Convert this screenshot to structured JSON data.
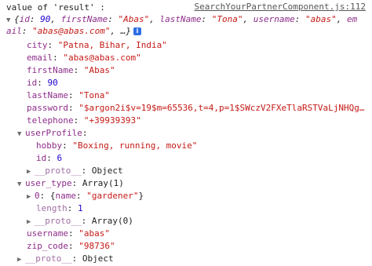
{
  "header": {
    "label": "value of 'result' :",
    "source_link": "SearchYourPartnerComponent.js:112"
  },
  "preview": {
    "line1_open": "{",
    "id_key": "id",
    "id_val": "90",
    "firstName_key": "firstName",
    "firstName_val": "\"Abas\"",
    "lastName_key": "lastName",
    "lastName_val": "\"Tona\"",
    "username_key": "username",
    "username_val": "\"abas\"",
    "em_key_part": "em",
    "line2_email_key_part": "ail",
    "line2_email_val": "\"abas@abas.com\"",
    "line2_tail": ", …}",
    "info_icon": "i"
  },
  "props": [
    {
      "key": "city",
      "value": "\"Patna, Bihar, India\"",
      "type": "str"
    },
    {
      "key": "email",
      "value": "\"abas@abas.com\"",
      "type": "str"
    },
    {
      "key": "firstName",
      "value": "\"Abas\"",
      "type": "str"
    },
    {
      "key": "id",
      "value": "90",
      "type": "num"
    },
    {
      "key": "lastName",
      "value": "\"Tona\"",
      "type": "str"
    },
    {
      "key": "password",
      "value": "\"$argon2i$v=19$m=65536,t=4,p=1$SWczV2FXeTlaRSTVaLjNHQg…",
      "type": "str"
    },
    {
      "key": "telephone",
      "value": "\"+39939393\"",
      "type": "str"
    }
  ],
  "userProfile": {
    "key": "userProfile",
    "hobby_key": "hobby",
    "hobby_val": "\"Boxing, running, movie\"",
    "id_key": "id",
    "id_val": "6",
    "proto_key": "__proto__",
    "proto_val": "Object"
  },
  "user_type": {
    "key": "user_type",
    "value": "Array(1)",
    "item0_key": "0",
    "item0_preview_key": "name",
    "item0_preview_val": "\"gardener\"",
    "length_key": "length",
    "length_val": "1",
    "proto_key": "__proto__",
    "proto_val": "Array(0)"
  },
  "tail_props": [
    {
      "key": "username",
      "value": "\"abas\"",
      "type": "str"
    },
    {
      "key": "zip_code",
      "value": "\"98736\"",
      "type": "str"
    }
  ],
  "root_proto": {
    "key": "__proto__",
    "value": "Object"
  },
  "colors": {
    "key": "#8e2d8a",
    "string": "#c41a16",
    "number": "#1c00cf",
    "info_icon": "#2f6fe4"
  }
}
